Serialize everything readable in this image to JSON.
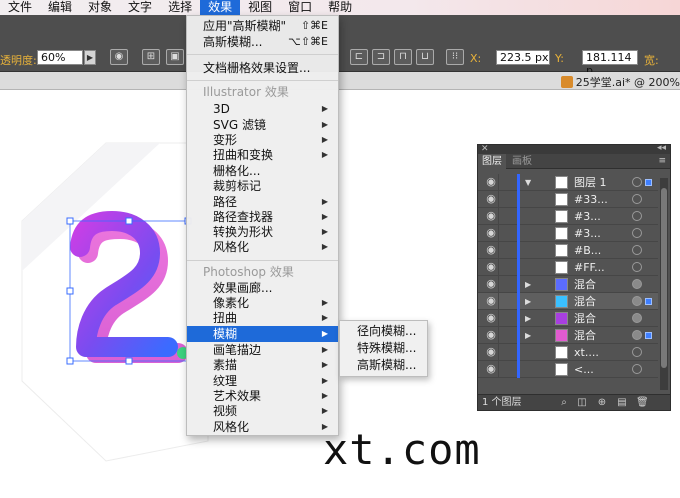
{
  "menubar": {
    "items": [
      {
        "label": "文件"
      },
      {
        "label": "编辑"
      },
      {
        "label": "对象"
      },
      {
        "label": "文字"
      },
      {
        "label": "选择"
      },
      {
        "label": "效果",
        "active": true
      },
      {
        "label": "视图"
      },
      {
        "label": "窗口"
      },
      {
        "label": "帮助"
      }
    ]
  },
  "toolbar": {
    "opacity_label": "透明度:",
    "opacity_value": "60%",
    "x_label": "X:",
    "x_value": "223.5 px",
    "y_label": "Y:",
    "y_value": "181.114 p",
    "w_label": "宽:"
  },
  "document": {
    "title": "25学堂.ai* @ 200%"
  },
  "effect_menu": {
    "apply_last": {
      "label": "应用\"高斯模糊\"",
      "shortcut": "⇧⌘E"
    },
    "last_effect": {
      "label": "高斯模糊...",
      "shortcut": "⌥⇧⌘E"
    },
    "doc_raster": {
      "label": "文档栅格效果设置..."
    },
    "illustrator_header": "Illustrator 效果",
    "illustrator_items": [
      {
        "label": "3D",
        "submenu": true
      },
      {
        "label": "SVG 滤镜",
        "submenu": true
      },
      {
        "label": "变形",
        "submenu": true
      },
      {
        "label": "扭曲和变换",
        "submenu": true
      },
      {
        "label": "栅格化...",
        "submenu": false
      },
      {
        "label": "裁剪标记",
        "submenu": false
      },
      {
        "label": "路径",
        "submenu": true
      },
      {
        "label": "路径查找器",
        "submenu": true
      },
      {
        "label": "转换为形状",
        "submenu": true
      },
      {
        "label": "风格化",
        "submenu": true
      }
    ],
    "photoshop_header": "Photoshop 效果",
    "photoshop_items": [
      {
        "label": "效果画廊...",
        "submenu": false
      },
      {
        "label": "像素化",
        "submenu": true
      },
      {
        "label": "扭曲",
        "submenu": true
      },
      {
        "label": "模糊",
        "submenu": true,
        "highlighted": true
      },
      {
        "label": "画笔描边",
        "submenu": true
      },
      {
        "label": "素描",
        "submenu": true
      },
      {
        "label": "纹理",
        "submenu": true
      },
      {
        "label": "艺术效果",
        "submenu": true
      },
      {
        "label": "视频",
        "submenu": true
      },
      {
        "label": "风格化",
        "submenu": true
      }
    ]
  },
  "blur_submenu": {
    "items": [
      {
        "label": "径向模糊..."
      },
      {
        "label": "特殊模糊..."
      },
      {
        "label": "高斯模糊..."
      }
    ]
  },
  "layers_panel": {
    "tabs": [
      {
        "label": "图层",
        "active": true
      },
      {
        "label": "画板",
        "active": false
      }
    ],
    "rows": [
      {
        "label": "图层 1",
        "twirl": "▼",
        "target_filled": false,
        "selected": true
      },
      {
        "label": "#33...",
        "twirl": "",
        "target_filled": false,
        "selected": false
      },
      {
        "label": "#3...",
        "twirl": "",
        "target_filled": false,
        "selected": false
      },
      {
        "label": "#3...",
        "twirl": "",
        "target_filled": false,
        "selected": false
      },
      {
        "label": "#B...",
        "twirl": "",
        "target_filled": false,
        "selected": false
      },
      {
        "label": "#FF...",
        "twirl": "",
        "target_filled": false,
        "selected": false
      },
      {
        "label": "混合",
        "twirl": "▶",
        "target_filled": true,
        "selected": false
      },
      {
        "label": "混合",
        "twirl": "▶",
        "target_filled": true,
        "selected": true
      },
      {
        "label": "混合",
        "twirl": "▶",
        "target_filled": true,
        "selected": false
      },
      {
        "label": "混合",
        "twirl": "▶",
        "target_filled": true,
        "selected": true
      },
      {
        "label": "xt....",
        "twirl": "",
        "target_filled": false,
        "selected": false
      },
      {
        "label": "<...",
        "twirl": "",
        "target_filled": false,
        "selected": false
      }
    ],
    "footer_count": "1 个图层"
  },
  "watermark": "xt.com",
  "colors": {
    "menu_highlight": "#1e6ad9",
    "toolbar_bg": "#4e4e4e",
    "panel_bg": "#535353",
    "label_orange": "#e8b23a",
    "glyph_purple": "#a83fe0",
    "glyph_blue": "#5b6cff",
    "glyph_pink": "#e25bd0"
  }
}
